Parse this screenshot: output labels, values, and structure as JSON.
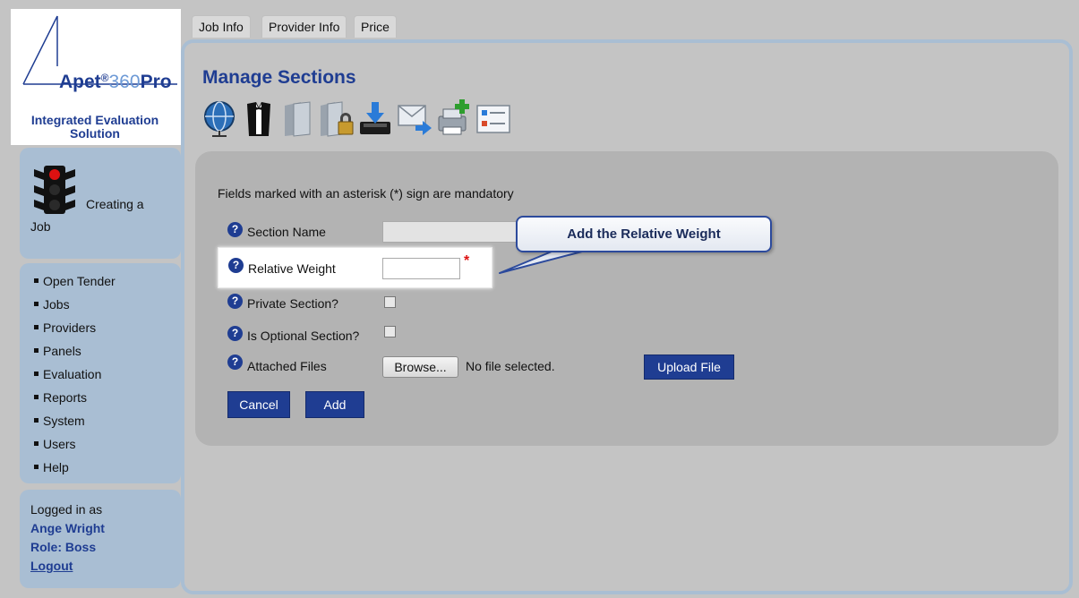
{
  "logo": {
    "brand_a": "Apet",
    "brand_reg": "®",
    "brand_num": "360",
    "brand_pro": "Pro",
    "subtitle_line1": "Integrated Evaluation",
    "subtitle_line2": "Solution"
  },
  "status": {
    "text_line1": "Creating a",
    "text_line2": "Job",
    "icon": "traffic-light-icon"
  },
  "nav": {
    "items": [
      "Open Tender",
      "Jobs",
      "Providers",
      "Panels",
      "Evaluation",
      "Reports",
      "System",
      "Users",
      "Help"
    ]
  },
  "user": {
    "logged_in_label": "Logged in as",
    "name": "Ange Wright",
    "role": "Role: Boss",
    "logout": "Logout"
  },
  "tabs": [
    {
      "label": "Job Info"
    },
    {
      "label": "Provider Info"
    },
    {
      "label": "Price"
    }
  ],
  "page": {
    "title": "Manage Sections"
  },
  "toolbar": {
    "icons": [
      "globe-icon",
      "tuxedo-icon",
      "folder-icon",
      "folder-lock-icon",
      "inbox-download-icon",
      "mail-forward-icon",
      "add-printer-icon",
      "list-icon"
    ]
  },
  "form": {
    "mandatory_note": "Fields marked with an asterisk (*) sign are mandatory",
    "section_name_label": "Section Name",
    "relative_weight_label": "Relative Weight",
    "relative_weight_value": "",
    "asterisk": "*",
    "private_section_label": "Private Section?",
    "optional_section_label": "Is Optional Section?",
    "attached_files_label": "Attached Files",
    "browse_label": "Browse...",
    "no_file_text": "No file selected.",
    "upload_label": "Upload File",
    "cancel_label": "Cancel",
    "add_label": "Add",
    "help_glyph": "?"
  },
  "callout": {
    "text": "Add the Relative Weight"
  },
  "colors": {
    "brand": "#1f3d92",
    "panel": "#a9bed3",
    "background": "#c4c4c4"
  }
}
